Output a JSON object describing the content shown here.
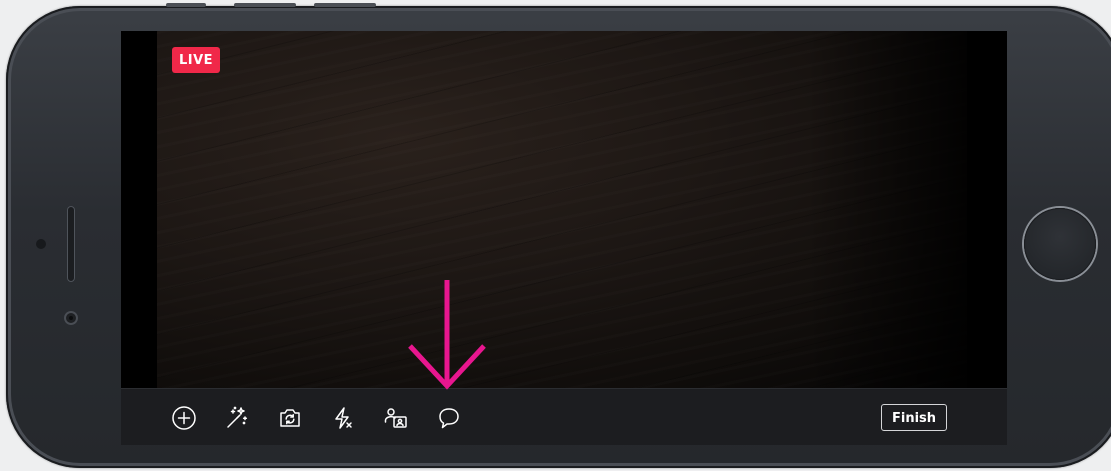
{
  "live_badge": "LIVE",
  "toolbar": {
    "tools": [
      {
        "name": "add",
        "icon": "plus-circle-icon"
      },
      {
        "name": "effects",
        "icon": "magic-wand-icon"
      },
      {
        "name": "flip-camera",
        "icon": "camera-flip-icon"
      },
      {
        "name": "flash",
        "icon": "flash-off-icon"
      },
      {
        "name": "invite-guest",
        "icon": "person-card-icon"
      },
      {
        "name": "comments",
        "icon": "comment-bubble-icon"
      }
    ],
    "finish_label": "Finish"
  },
  "colors": {
    "live": "#f02849",
    "annotation_arrow": "#e8168f",
    "toolbar_bg": "#1c1d20"
  }
}
